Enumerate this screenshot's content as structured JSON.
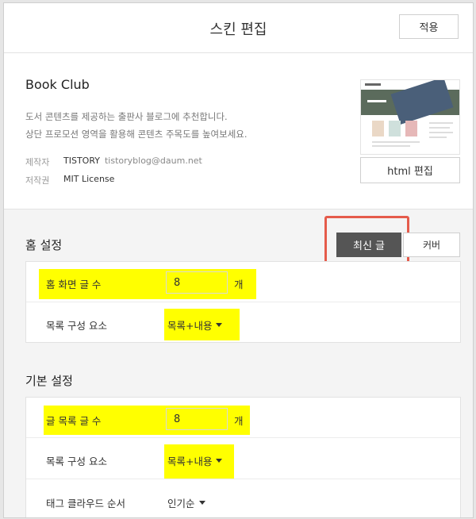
{
  "header": {
    "title": "스킨 편집",
    "apply_label": "적용"
  },
  "skin": {
    "name": "Book Club",
    "description": [
      "도서 콘텐츠를 제공하는 출판사 블로그에 추천합니다.",
      "상단 프로모션 영역을 활용해 콘텐츠 주목도를 높여보세요."
    ],
    "author_key": "제작자",
    "author_name": "TISTORY",
    "author_email": "tistoryblog@daum.net",
    "license_key": "저작권",
    "license": "MIT License",
    "html_edit_label": "html 편집"
  },
  "home": {
    "title": "홈 설정",
    "tabs": [
      {
        "label": "최신 글",
        "active": true
      },
      {
        "label": "커버",
        "active": false
      }
    ],
    "rows": [
      {
        "label": "홈 화면 글 수",
        "value": "8",
        "unit": "개"
      },
      {
        "label": "목록 구성 요소",
        "value": "목록+내용"
      }
    ]
  },
  "basic": {
    "title": "기본 설정",
    "rows": [
      {
        "label": "글 목록 글 수",
        "value": "8",
        "unit": "개"
      },
      {
        "label": "목록 구성 요소",
        "value": "목록+내용"
      },
      {
        "label": "태그 클라우드 순서",
        "value": "인기순"
      }
    ]
  },
  "colors": {
    "highlight": "#ffff00",
    "annotation_box": "#e55b4b",
    "active_tab": "#555555"
  }
}
